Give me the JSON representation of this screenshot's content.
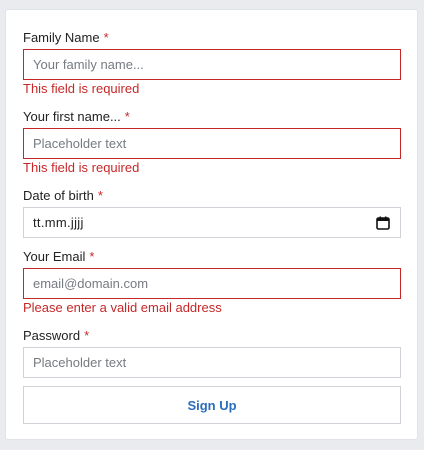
{
  "form": {
    "family_name": {
      "label": "Family Name",
      "required_mark": "*",
      "placeholder": "Your family name...",
      "error": "This field is required"
    },
    "first_name": {
      "label": "Your first name...",
      "required_mark": "*",
      "placeholder": "Placeholder text",
      "error": "This field is required"
    },
    "date_of_birth": {
      "label": "Date of birth",
      "required_mark": "*",
      "value": "tt.mm.jjjj",
      "icon": "calendar-icon"
    },
    "email": {
      "label": "Your Email",
      "required_mark": "*",
      "placeholder": "email@domain.com",
      "error": "Please enter a valid email address"
    },
    "password": {
      "label": "Password",
      "required_mark": "*",
      "placeholder": "Placeholder text"
    },
    "submit_label": "Sign Up"
  },
  "colors": {
    "error": "#c62828",
    "accent": "#2a6ebb",
    "border": "#cfd3d8",
    "background": "#e9ebee"
  }
}
